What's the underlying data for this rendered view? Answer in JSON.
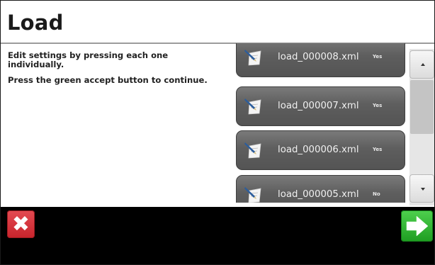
{
  "screen": {
    "title": "Load",
    "instructions": [
      "Edit settings by pressing each one individually.",
      "Press the green accept button to continue."
    ]
  },
  "files": [
    {
      "name": "load_000008.xml",
      "flag": "Yes"
    },
    {
      "name": "load_000007.xml",
      "flag": "Yes"
    },
    {
      "name": "load_000006.xml",
      "flag": "Yes"
    },
    {
      "name": "load_000005.xml",
      "flag": "No"
    }
  ],
  "icons": {
    "file": "document-pen-icon",
    "scroll_up": "arrow-up-icon",
    "scroll_down": "arrow-down-icon",
    "cancel": "close-icon",
    "accept": "arrow-right-icon"
  },
  "colors": {
    "cancel": "#d0262e",
    "accept": "#2fb331",
    "item_bg": "#626262",
    "footer": "#000000"
  }
}
